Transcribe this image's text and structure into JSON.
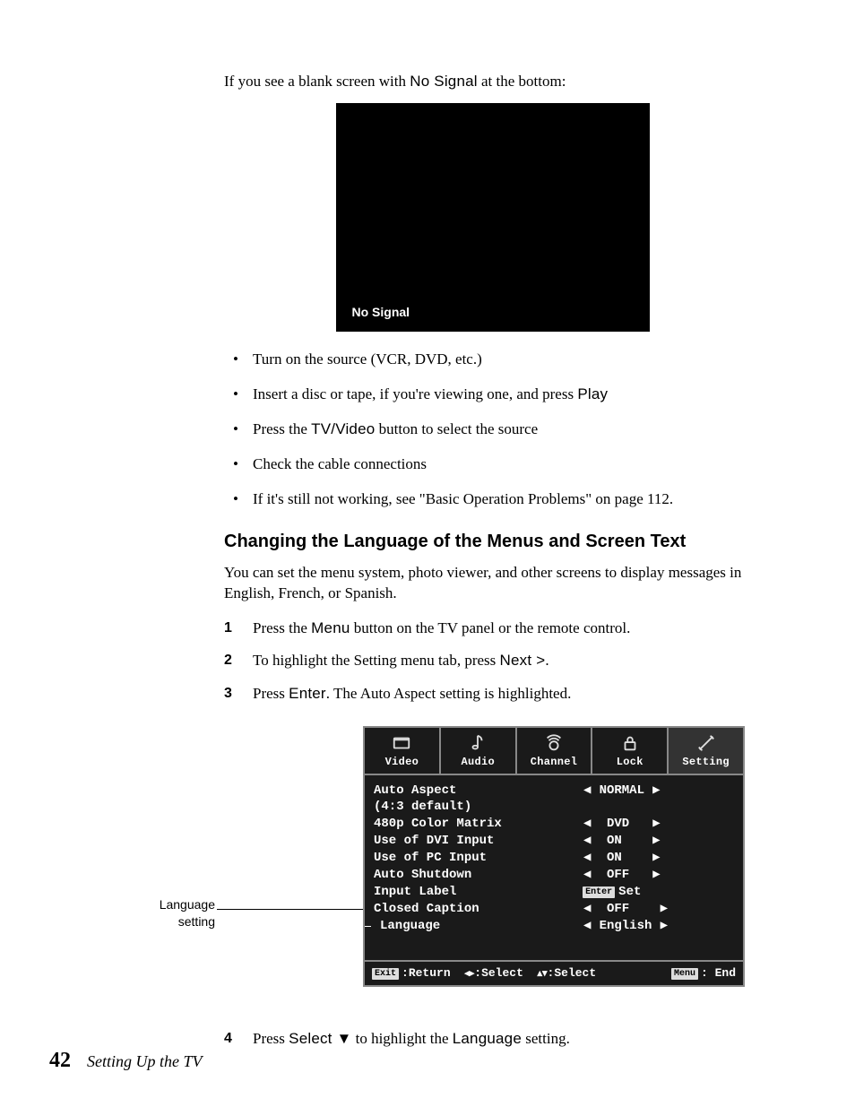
{
  "intro": {
    "prefix": "If you see a blank screen with ",
    "ui_term": "No Signal",
    "suffix": " at the bottom:"
  },
  "no_signal_box": {
    "label": "No Signal"
  },
  "bullets": [
    {
      "text": "Turn on the source (VCR, DVD, etc.)"
    },
    {
      "prefix": "Insert a disc or tape, if you're viewing one, and press ",
      "ui": "Play"
    },
    {
      "prefix": "Press the ",
      "ui": "TV/Video",
      "suffix": " button to select the source"
    },
    {
      "text": "Check the cable connections"
    },
    {
      "text": "If it's still not working, see \"Basic Operation Problems\" on page 112."
    }
  ],
  "section_heading": "Changing the Language of the Menus and Screen Text",
  "section_intro": "You can set the menu system, photo viewer, and other screens to display messages in English, French, or Spanish.",
  "steps": [
    {
      "num": "1",
      "prefix": "Press the ",
      "ui": "Menu",
      "suffix": " button on the TV panel or the remote control."
    },
    {
      "num": "2",
      "prefix": "To highlight the Setting menu tab, press ",
      "ui": "Next >",
      "suffix": "."
    },
    {
      "num": "3",
      "prefix": "Press ",
      "ui": "Enter",
      "suffix": ". The Auto Aspect setting is highlighted."
    },
    {
      "num": "4",
      "prefix": "Press ",
      "ui": "Select ",
      "glyph": "▼",
      "mid": " to highlight the ",
      "ui2": "Language",
      "suffix": " setting."
    }
  ],
  "osd": {
    "caption_line1": "Language",
    "caption_line2": "setting",
    "tabs": [
      "Video",
      "Audio",
      "Channel",
      "Lock",
      "Setting"
    ],
    "left_rows": [
      "Auto Aspect",
      " (4:3 default)",
      "480p Color Matrix",
      "Use of DVI Input",
      "Use of PC Input",
      "Auto Shutdown",
      "Input Label",
      "Closed Caption",
      "Language"
    ],
    "right_rows": [
      {
        "l": "◀",
        "v": "NORMAL",
        "r": "▶"
      },
      {
        "spacer": true
      },
      {
        "l": "◀",
        "v": "DVD",
        "r": "▶"
      },
      {
        "l": "◀",
        "v": "ON",
        "r": "▶"
      },
      {
        "l": "◀",
        "v": "ON",
        "r": "▶"
      },
      {
        "l": "◀",
        "v": "OFF",
        "r": "▶"
      },
      {
        "enter": true,
        "v": "Set"
      },
      {
        "l": "◀",
        "v": "OFF",
        "r": "▶"
      },
      {
        "l": "◀",
        "v": "English",
        "r": "▶"
      }
    ],
    "footer": {
      "left_badge": "Exit",
      "left_text": ":Return",
      "sel1": ":Select",
      "sel2": ":Select",
      "right_badge": "Menu",
      "right_text": ": End"
    }
  },
  "footer": {
    "page": "42",
    "running": "Setting Up the TV"
  }
}
